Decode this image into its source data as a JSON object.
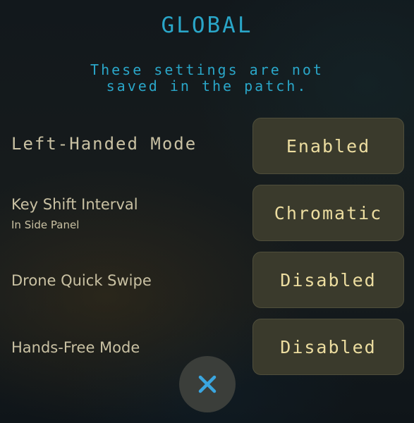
{
  "title": "GLOBAL",
  "notice": {
    "line1": "These settings are not",
    "line2": "saved in the patch."
  },
  "settings": [
    {
      "label": "Left-Handed Mode",
      "sublabel": "",
      "value": "Enabled"
    },
    {
      "label": "Key Shift Interval",
      "sublabel": "In Side Panel",
      "value": "Chromatic"
    },
    {
      "label": "Drone Quick Swipe",
      "sublabel": "",
      "value": "Disabled"
    },
    {
      "label": "Hands-Free Mode",
      "sublabel": "",
      "value": "Disabled"
    }
  ],
  "colors": {
    "accent_blue": "#2aa6c8",
    "label_text": "#c9c1a3",
    "button_bg": "#3a3a2c",
    "button_text": "#ecdda0",
    "close_icon": "#3aa6e0"
  },
  "close_icon": "close-icon"
}
